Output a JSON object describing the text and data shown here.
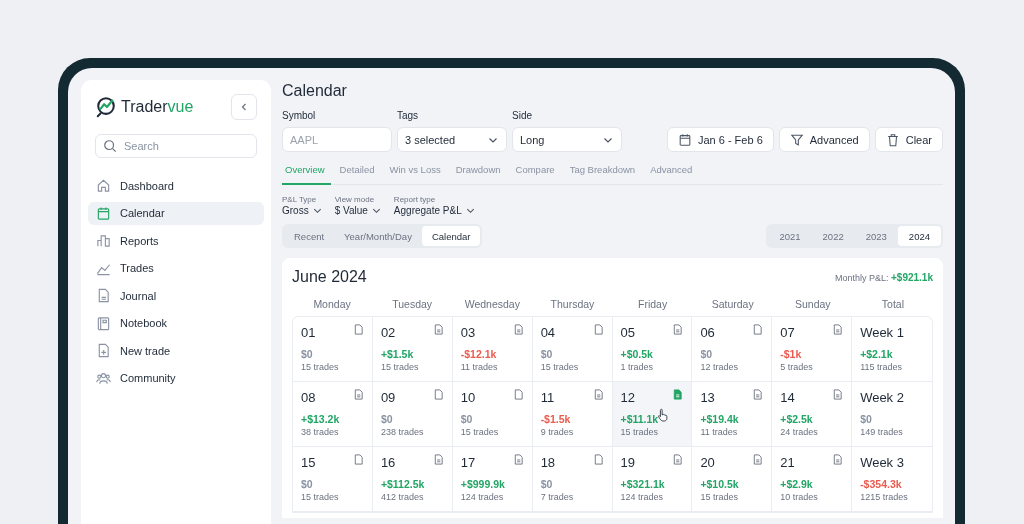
{
  "sidebar": {
    "brand": [
      "Trader",
      "vue"
    ],
    "search": {
      "placeholder": "Search"
    },
    "items": [
      {
        "label": "Dashboard",
        "selected": false
      },
      {
        "label": "Calendar",
        "selected": true
      },
      {
        "label": "Reports",
        "selected": false
      },
      {
        "label": "Trades",
        "selected": false
      },
      {
        "label": "Journal",
        "selected": false
      },
      {
        "label": "Notebook",
        "selected": false
      },
      {
        "label": "New trade",
        "selected": false
      },
      {
        "label": "Community",
        "selected": false
      }
    ]
  },
  "page": {
    "title": "Calendar"
  },
  "filters": [
    {
      "label": "Symbol",
      "kind": "input",
      "placeholder": "AAPL"
    },
    {
      "label": "Tags",
      "kind": "select",
      "value": "3 selected"
    },
    {
      "label": "Side",
      "kind": "select",
      "value": "Long"
    }
  ],
  "actions": [
    {
      "label": "Jan 6 - Feb 6",
      "kind": "date"
    },
    {
      "label": "Advanced",
      "kind": "filter"
    },
    {
      "label": "Clear",
      "kind": "clear"
    }
  ],
  "tabs": [
    {
      "label": "Overview",
      "selected": true
    },
    {
      "label": "Detailed",
      "selected": false
    },
    {
      "label": "Win vs Loss",
      "selected": false
    },
    {
      "label": "Drawdown",
      "selected": false
    },
    {
      "label": "Compare",
      "selected": false
    },
    {
      "label": "Tag Breakdown",
      "selected": false
    },
    {
      "label": "Advanced",
      "selected": false
    }
  ],
  "options": [
    {
      "label": "P&L Type",
      "value": "Gross"
    },
    {
      "label": "View mode",
      "value": "$ Value"
    },
    {
      "label": "Report type",
      "value": "Aggregate P&L"
    }
  ],
  "views": [
    {
      "label": "Recent",
      "selected": false
    },
    {
      "label": "Year/Month/Day",
      "selected": false
    },
    {
      "label": "Calendar",
      "selected": true
    }
  ],
  "years": [
    {
      "label": "2021",
      "selected": false
    },
    {
      "label": "2022",
      "selected": false
    },
    {
      "label": "2023",
      "selected": false
    },
    {
      "label": "2024",
      "selected": true
    }
  ],
  "calendar": {
    "month": "June 2024",
    "monthly_label": "Monthly P&L:",
    "monthly_value": "+$921.1k",
    "headers": [
      "Monday",
      "Tuesday",
      "Wednesday",
      "Thursday",
      "Friday",
      "Saturday",
      "Sunday",
      "Total"
    ],
    "weeks": [
      {
        "days": [
          {
            "day": "01",
            "pnl": "$0",
            "trades": "15 trades",
            "color": "#8a93a3",
            "has_note": false,
            "selected": false
          },
          {
            "day": "02",
            "pnl": "+$1.5k",
            "trades": "15 trades",
            "color": "#22a565",
            "has_note": true,
            "selected": false
          },
          {
            "day": "03",
            "pnl": "-$12.1k",
            "trades": "11 trades",
            "color": "#ea5b4f",
            "has_note": true,
            "selected": false
          },
          {
            "day": "04",
            "pnl": "$0",
            "trades": "15 trades",
            "color": "#8a93a3",
            "has_note": false,
            "selected": false
          },
          {
            "day": "05",
            "pnl": "+$0.5k",
            "trades": "1 trades",
            "color": "#22a565",
            "has_note": true,
            "selected": false
          },
          {
            "day": "06",
            "pnl": "$0",
            "trades": "12 trades",
            "color": "#8a93a3",
            "has_note": false,
            "selected": false
          },
          {
            "day": "07",
            "pnl": "-$1k",
            "trades": "5 trades",
            "color": "#ea5b4f",
            "has_note": true,
            "selected": false
          }
        ],
        "total": {
          "label": "Week 1",
          "pnl": "+$2.1k",
          "trades": "115 trades",
          "color": "#22a565"
        }
      },
      {
        "days": [
          {
            "day": "08",
            "pnl": "+$13.2k",
            "trades": "38 trades",
            "color": "#22a565",
            "has_note": true,
            "selected": false
          },
          {
            "day": "09",
            "pnl": "$0",
            "trades": "238 trades",
            "color": "#8a93a3",
            "has_note": false,
            "selected": false
          },
          {
            "day": "10",
            "pnl": "$0",
            "trades": "15 trades",
            "color": "#8a93a3",
            "has_note": false,
            "selected": false
          },
          {
            "day": "11",
            "pnl": "-$1.5k",
            "trades": "9 trades",
            "color": "#ea5b4f",
            "has_note": true,
            "selected": false
          },
          {
            "day": "12",
            "pnl": "+$11.1k",
            "trades": "15 trades",
            "color": "#22a565",
            "has_note": true,
            "selected": true
          },
          {
            "day": "13",
            "pnl": "+$19.4k",
            "trades": "11 trades",
            "color": "#22a565",
            "has_note": true,
            "selected": false
          },
          {
            "day": "14",
            "pnl": "+$2.5k",
            "trades": "24 trades",
            "color": "#22a565",
            "has_note": true,
            "selected": false
          }
        ],
        "total": {
          "label": "Week 2",
          "pnl": "$0",
          "trades": "149 trades",
          "color": "#8a93a3"
        }
      },
      {
        "days": [
          {
            "day": "15",
            "pnl": "$0",
            "trades": "15 trades",
            "color": "#8a93a3",
            "has_note": false,
            "selected": false
          },
          {
            "day": "16",
            "pnl": "+$112.5k",
            "trades": "412 trades",
            "color": "#22a565",
            "has_note": true,
            "selected": false
          },
          {
            "day": "17",
            "pnl": "+$999.9k",
            "trades": "124 trades",
            "color": "#22a565",
            "has_note": true,
            "selected": false
          },
          {
            "day": "18",
            "pnl": "$0",
            "trades": "7 trades",
            "color": "#8a93a3",
            "has_note": false,
            "selected": false
          },
          {
            "day": "19",
            "pnl": "+$321.1k",
            "trades": "124 trades",
            "color": "#22a565",
            "has_note": true,
            "selected": false
          },
          {
            "day": "20",
            "pnl": "+$10.5k",
            "trades": "15 trades",
            "color": "#22a565",
            "has_note": true,
            "selected": false
          },
          {
            "day": "21",
            "pnl": "+$2.9k",
            "trades": "10 trades",
            "color": "#22a565",
            "has_note": true,
            "selected": false
          }
        ],
        "total": {
          "label": "Week 3",
          "pnl": "-$354.3k",
          "trades": "1215 trades",
          "color": "#ea5b4f"
        }
      }
    ]
  }
}
